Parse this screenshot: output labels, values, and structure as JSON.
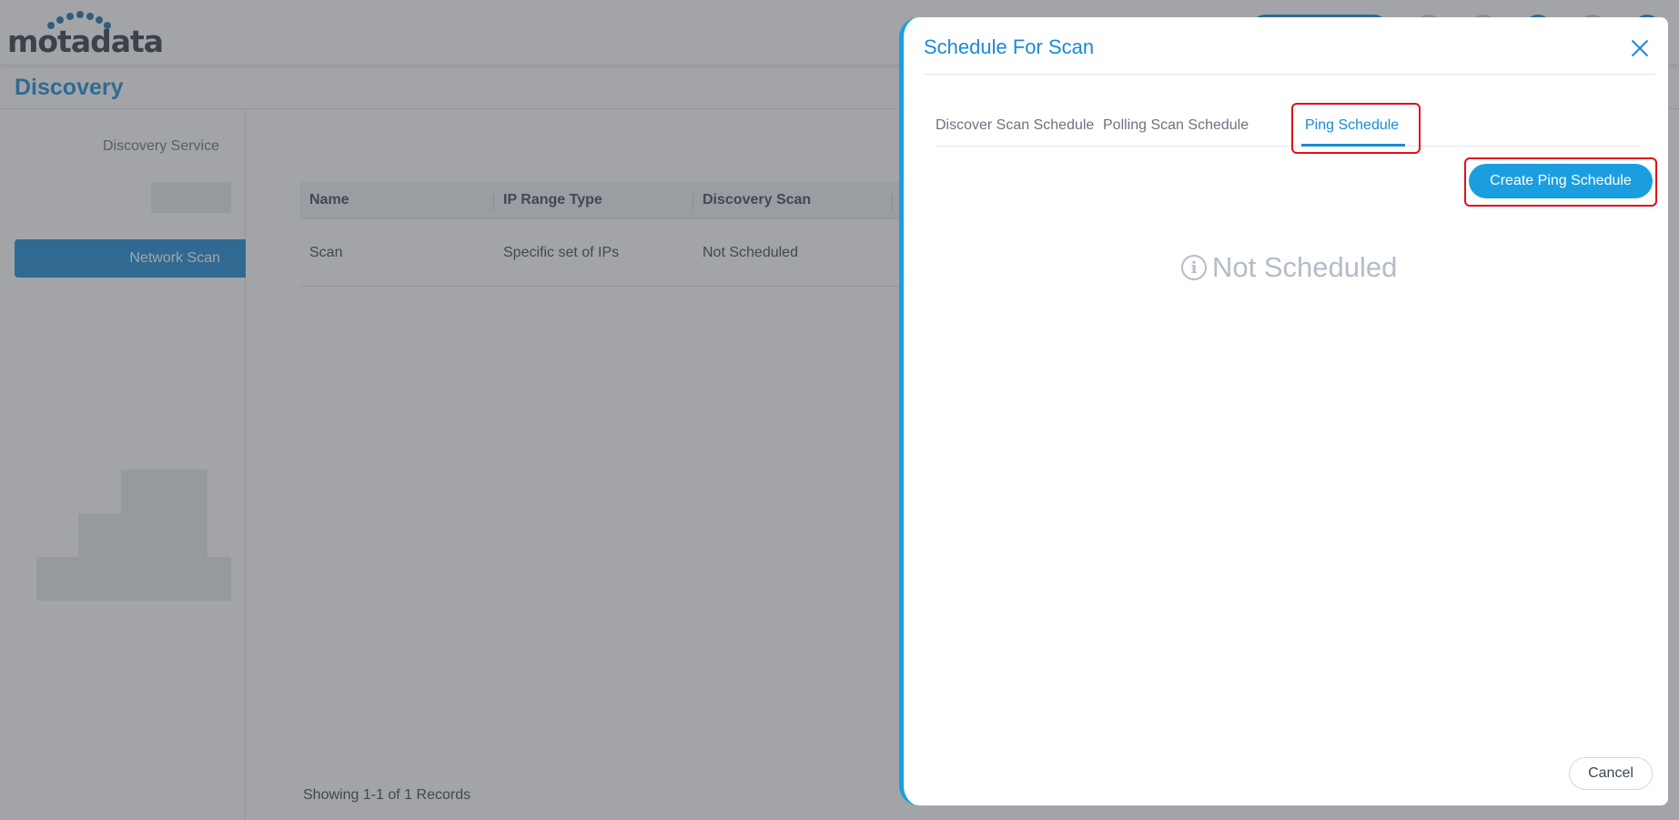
{
  "app": {
    "logo_text": "motadata",
    "page_title": "Discovery"
  },
  "sidebar": {
    "discovery_service_label": "Discovery Service",
    "active_item_label": "Network Scan"
  },
  "table": {
    "columns": [
      "Name",
      "IP Range Type",
      "Discovery Scan"
    ],
    "rows": [
      [
        "Scan",
        "Specific set of IPs",
        "Not Scheduled"
      ]
    ],
    "footer": "Showing 1-1 of 1 Records"
  },
  "drawer": {
    "title": "Schedule For Scan",
    "tabs": [
      {
        "label": "Discover Scan Schedule",
        "active": false
      },
      {
        "label": "Polling Scan Schedule",
        "active": false
      },
      {
        "label": "Ping Schedule",
        "active": true
      }
    ],
    "create_button_label": "Create Ping Schedule",
    "empty_state_text": "Not Scheduled",
    "cancel_button_label": "Cancel"
  },
  "colors": {
    "accent": "#1a8ad4",
    "button_primary": "#1a9ee0",
    "highlight_border": "#e0101a",
    "empty_state": "#b3bcc8"
  },
  "icons": {
    "close": "close-icon",
    "info": "info-icon"
  }
}
